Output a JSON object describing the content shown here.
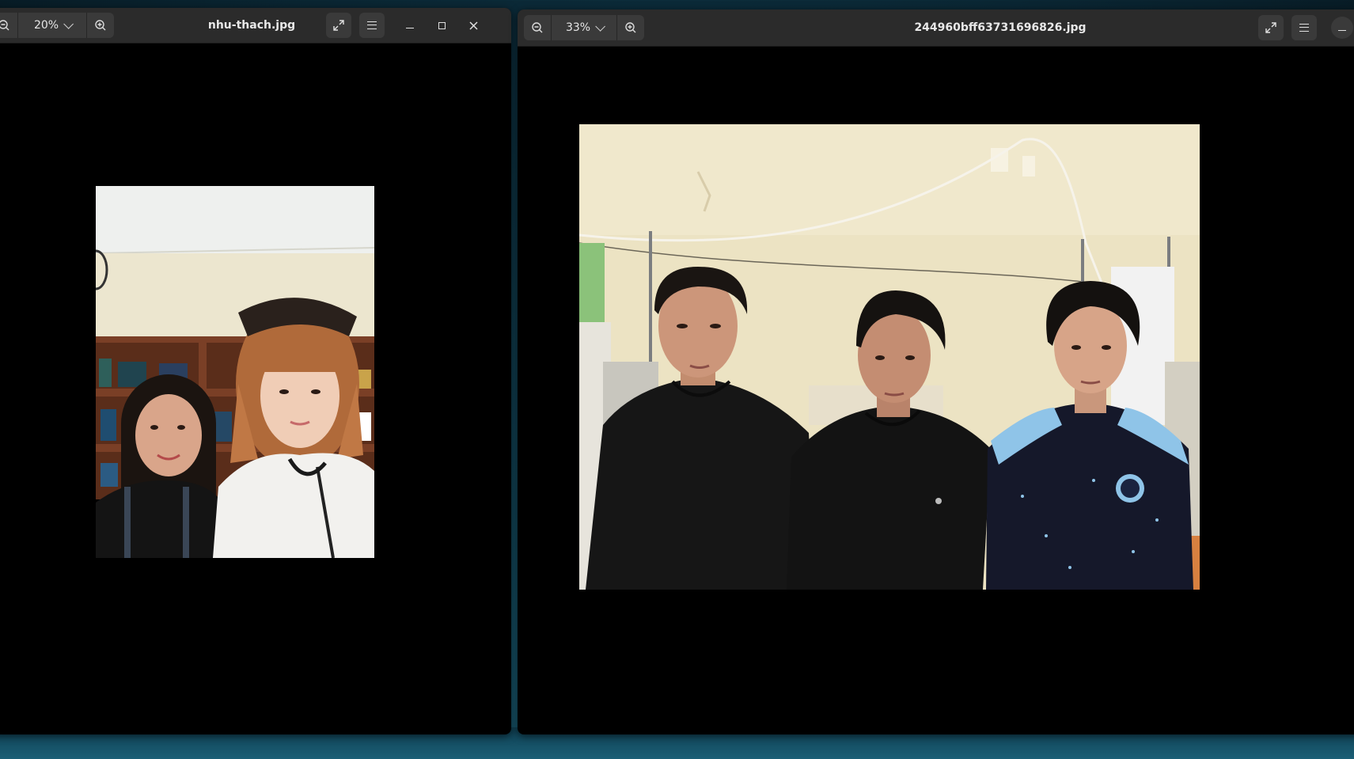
{
  "left_window": {
    "zoom_level": "20%",
    "title": "nhu-thach.jpg",
    "icons": {
      "zoom_out": "zoom-out-icon",
      "zoom_in": "zoom-in-icon",
      "fullscreen": "fullscreen-icon",
      "menu": "hamburger-menu-icon",
      "minimize": "minimize-icon",
      "maximize": "maximize-icon",
      "close": "close-icon"
    }
  },
  "right_window": {
    "zoom_level": "33%",
    "title": "244960bff63731696826.jpg",
    "icons": {
      "zoom_out": "zoom-out-icon",
      "zoom_in": "zoom-in-icon",
      "fullscreen": "fullscreen-icon",
      "menu": "hamburger-menu-icon",
      "minimize": "minimize-icon"
    }
  },
  "colors": {
    "headerbar": "#2b2b2b",
    "button_bg": "#3a3a3a",
    "canvas": "#000000",
    "wall_left_photo": "#ece6cf",
    "wall_right_photo": "#ece3c3"
  }
}
